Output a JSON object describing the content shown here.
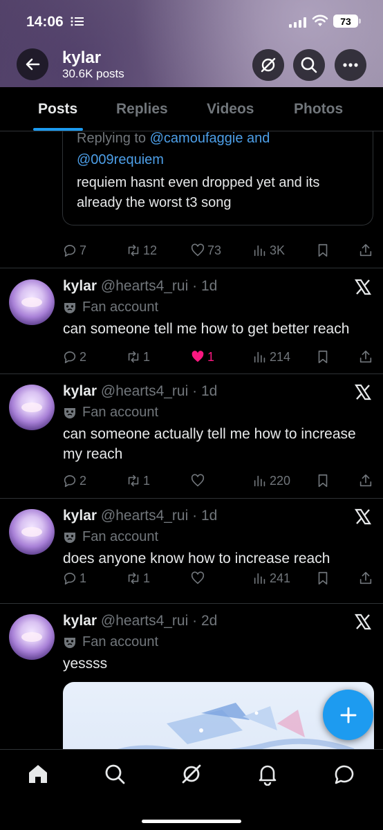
{
  "status_bar": {
    "time": "14:06",
    "battery": "73"
  },
  "profile": {
    "name": "kylar",
    "posts": "30.6K posts"
  },
  "tabs": [
    "Posts",
    "Replies",
    "Videos",
    "Photos"
  ],
  "quoted": {
    "replying_prefix": "Replying to ",
    "mention1": "@camoufaggie",
    "and": " and",
    "mention2": "@009requiem",
    "text": "requiem hasnt even dropped yet and its already the worst t3 song"
  },
  "top_actions": {
    "replies": "7",
    "reposts": "12",
    "likes": "73",
    "views": "3K"
  },
  "tweets": [
    {
      "name": "kylar",
      "handle": "@hearts4_rui",
      "time": "1d",
      "label": "Fan account",
      "text": "can someone tell me how to get better reach",
      "replies": "2",
      "reposts": "1",
      "likes": "1",
      "liked": true,
      "views": "214"
    },
    {
      "name": "kylar",
      "handle": "@hearts4_rui",
      "time": "1d",
      "label": "Fan account",
      "text": "can someone actually tell me how to increase my reach",
      "replies": "2",
      "reposts": "1",
      "likes": "",
      "liked": false,
      "views": "220"
    },
    {
      "name": "kylar",
      "handle": "@hearts4_rui",
      "time": "1d",
      "label": "Fan account",
      "text": "does anyone know how to increase reach",
      "replies": "1",
      "reposts": "1",
      "likes": "",
      "liked": false,
      "views": "241"
    },
    {
      "name": "kylar",
      "handle": "@hearts4_rui",
      "time": "2d",
      "label": "Fan account",
      "text": "yessss"
    }
  ],
  "colors": {
    "accent": "#1d9bf0",
    "like": "#f91880",
    "muted": "#71767b",
    "background": "#000000"
  },
  "icons": [
    "back-arrow-icon",
    "grok-icon",
    "search-icon",
    "more-icon",
    "reply-icon",
    "repost-icon",
    "heart-icon",
    "views-icon",
    "bookmark-icon",
    "share-icon",
    "x-logo-icon",
    "mask-icon",
    "compose-icon",
    "home-icon",
    "bell-icon",
    "messages-icon"
  ]
}
